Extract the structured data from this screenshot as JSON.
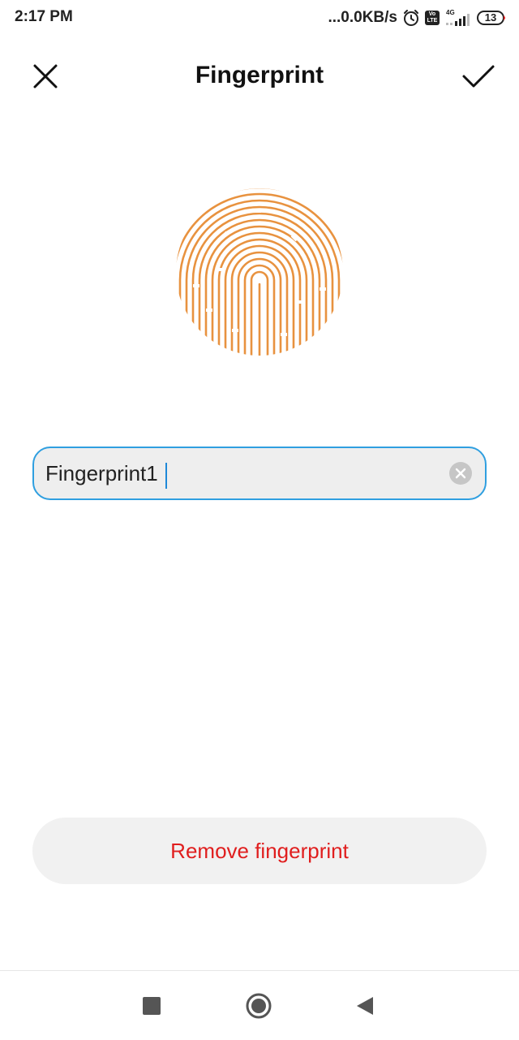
{
  "status_bar": {
    "time": "2:17 PM",
    "net_speed": "...0.0KB/s",
    "volte_top": "Vo",
    "volte_bottom": "LTE",
    "network_type": "4G",
    "battery_level": "13",
    "icons": [
      "alarm-icon",
      "volte-icon",
      "signal-icon",
      "battery-icon"
    ]
  },
  "header": {
    "title": "Fingerprint",
    "close_icon": "close-icon",
    "confirm_icon": "check-icon"
  },
  "fingerprint": {
    "icon": "fingerprint-icon",
    "color": "#E8923F"
  },
  "name_field": {
    "value": "Fingerprint1",
    "clear_icon": "clear-icon",
    "border_color": "#2F9FE0"
  },
  "remove_button": {
    "label": "Remove fingerprint",
    "color": "#E01E1E"
  },
  "nav_bar": {
    "icons": [
      "recents-icon",
      "home-icon",
      "back-icon"
    ]
  }
}
